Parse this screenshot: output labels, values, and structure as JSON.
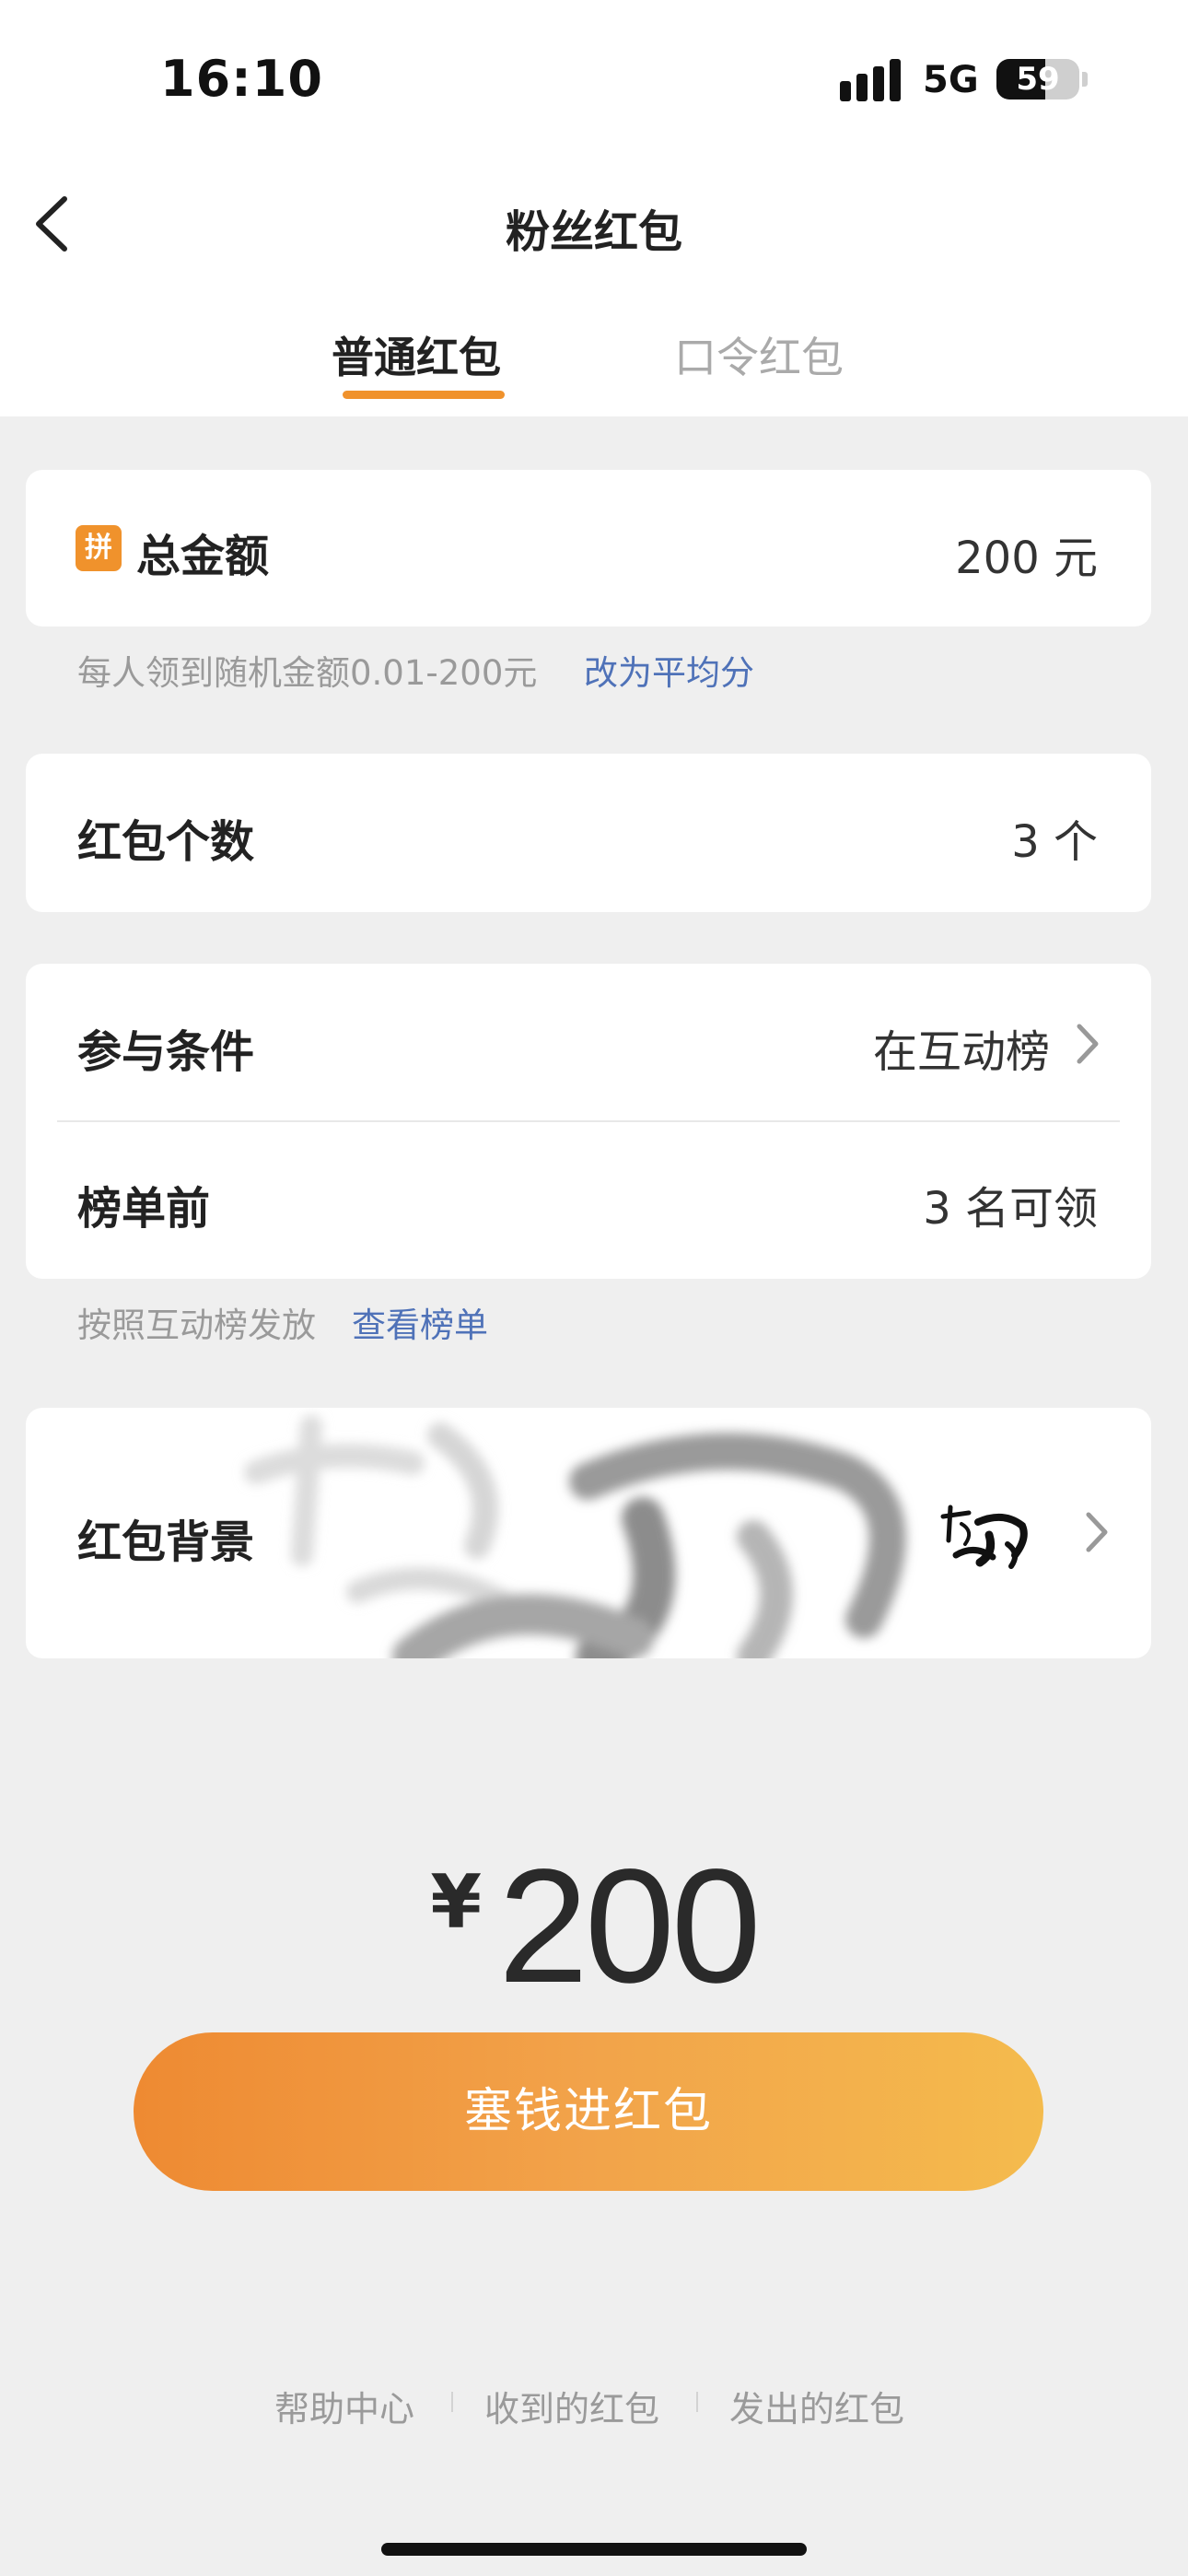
{
  "status_bar": {
    "time": "16:10",
    "network": "5G",
    "battery": "59",
    "battery_level": 0.59
  },
  "nav": {
    "title": "粉丝红包"
  },
  "tabs": [
    {
      "label": "普通红包",
      "active": true
    },
    {
      "label": "口令红包",
      "active": false
    }
  ],
  "total": {
    "badge": "拼",
    "label": "总金额",
    "value": "200 元"
  },
  "total_hint": {
    "text": "每人领到随机金额0.01-200元",
    "link": "改为平均分"
  },
  "count": {
    "label": "红包个数",
    "value": "3 个"
  },
  "condition": {
    "label": "参与条件",
    "value": "在互动榜"
  },
  "rank": {
    "label": "榜单前",
    "value": "3 名可领"
  },
  "condition_hint": {
    "text": "按照互动榜发放",
    "link": "查看榜单"
  },
  "background": {
    "label": "红包背景"
  },
  "amount": {
    "symbol": "¥",
    "value": "200"
  },
  "submit": {
    "label": "塞钱进红包"
  },
  "footer": {
    "links": [
      "帮助中心",
      "收到的红包",
      "发出的红包"
    ]
  },
  "colors": {
    "accent": "#f0922c",
    "link": "#4f72b8",
    "page_bg": "#efefef",
    "button_start": "#ee8a32",
    "button_end": "#f4bb4d"
  }
}
